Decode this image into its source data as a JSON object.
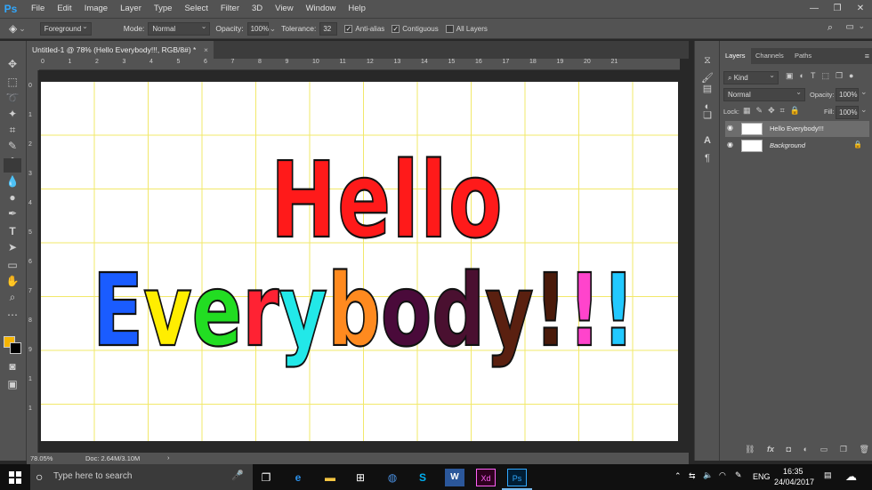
{
  "app": {
    "logo": "Ps",
    "accent_color": "#31a8ff"
  },
  "menu": [
    "File",
    "Edit",
    "Image",
    "Layer",
    "Type",
    "Select",
    "Filter",
    "3D",
    "View",
    "Window",
    "Help"
  ],
  "window_controls": {
    "minimize": "—",
    "maximize": "❐",
    "close": "✕"
  },
  "options": {
    "fill_source": "Foreground",
    "mode_label": "Mode:",
    "mode_value": "Normal",
    "opacity_label": "Opacity:",
    "opacity_value": "100%",
    "tolerance_label": "Tolerance:",
    "tolerance_value": "32",
    "antialias_label": "Anti-alias",
    "antialias_checked": true,
    "contiguous_label": "Contiguous",
    "contiguous_checked": true,
    "alllayers_label": "All Layers",
    "alllayers_checked": false
  },
  "document": {
    "tab_title": "Untitled-1 @ 78% (Hello Everybody!!!, RGB/8#) *",
    "close": "×",
    "canvas_line1": "Hello",
    "canvas_line2": "Everybody!!!",
    "line1_color": "#ff1a1a",
    "line2_colors": [
      "#1a5cff",
      "#ffee00",
      "#22dd22",
      "#ff2233",
      "#22e8e8",
      "#ff8a1f",
      "#4a0a3a",
      "#4a1030",
      "#5a2010",
      "#4a1a0a",
      "#ff44cc",
      "#22c9ff",
      "#ffdd00",
      "#ff1a4a",
      "#e85520"
    ]
  },
  "ruler_top": [
    "0",
    "1",
    "2",
    "3",
    "4",
    "5",
    "6",
    "7",
    "8",
    "9",
    "10",
    "11",
    "12",
    "13",
    "14",
    "15",
    "16",
    "17",
    "18",
    "19",
    "20",
    "21"
  ],
  "ruler_left": [
    "0",
    "1",
    "2",
    "3",
    "4",
    "5",
    "6",
    "7",
    "8",
    "9",
    "1",
    "1"
  ],
  "status": {
    "zoom": "78.05%",
    "doc": "Doc: 2.64M/3.10M",
    "arrow": "›"
  },
  "panel_icons": [
    "history-icon",
    "brush-icon",
    "actions-icon",
    "adjust-icon",
    "layers-comp-icon",
    "character-icon",
    "paragraph-icon"
  ],
  "layers": {
    "tabs": [
      "Layers",
      "Channels",
      "Paths"
    ],
    "kind_label": "Kind",
    "blend_mode": "Normal",
    "opacity_label": "Opacity:",
    "opacity_value": "100%",
    "lock_label": "Lock:",
    "fill_label": "Fill:",
    "fill_value": "100%",
    "items": [
      {
        "name": "Hello Everybody!!!",
        "selected": true
      },
      {
        "name": "Background",
        "selected": false,
        "locked": true
      }
    ],
    "bottom_icons": [
      "link-icon",
      "fx-icon",
      "mask-icon",
      "adjustment-icon",
      "group-icon",
      "new-layer-icon",
      "trash-icon"
    ],
    "fx_label": "fx"
  },
  "taskbar": {
    "search_placeholder": "Type here to search",
    "lang": "ENG",
    "time": "16:35",
    "date": "24/04/2017",
    "apps": [
      "task-view",
      "edge",
      "file-explorer",
      "store",
      "chrome",
      "skype",
      "word",
      "xd",
      "photoshop"
    ],
    "app_labels": {
      "word": "W",
      "xd": "Xd",
      "ps": "Ps"
    }
  }
}
